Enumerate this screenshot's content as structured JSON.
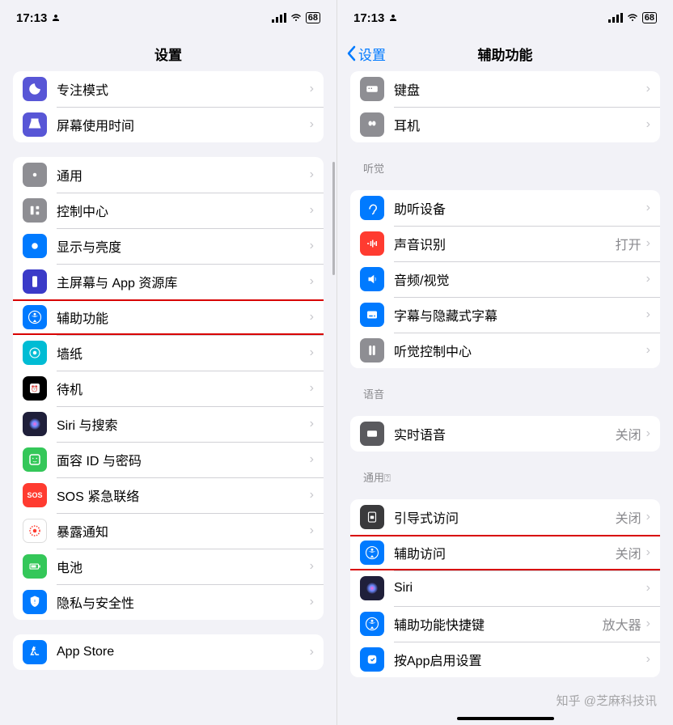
{
  "statusbar": {
    "time": "17:13",
    "battery": "68"
  },
  "left": {
    "title": "设置",
    "g1": [
      {
        "n": "focus",
        "l": "专注模式",
        "c": "#5856d6"
      },
      {
        "n": "screentime",
        "l": "屏幕使用时间",
        "c": "#5856d6"
      }
    ],
    "g2": [
      {
        "n": "general",
        "l": "通用",
        "c": "#8e8e93"
      },
      {
        "n": "control",
        "l": "控制中心",
        "c": "#8e8e93"
      },
      {
        "n": "display",
        "l": "显示与亮度",
        "c": "#007aff"
      },
      {
        "n": "home",
        "l": "主屏幕与 App 资源库",
        "c": "#3a3ac8"
      },
      {
        "n": "accessibility",
        "l": "辅助功能",
        "c": "#007aff",
        "hl": true
      },
      {
        "n": "wallpaper",
        "l": "墙纸",
        "c": "#00bcd4"
      },
      {
        "n": "standby",
        "l": "待机",
        "c": "#000000"
      },
      {
        "n": "siri",
        "l": "Siri 与搜索",
        "c": "#1f1f3a"
      },
      {
        "n": "faceid",
        "l": "面容 ID 与密码",
        "c": "#34c759"
      },
      {
        "n": "sos",
        "l": "SOS 紧急联络",
        "c": "#ff3b30",
        "txt": "SOS"
      },
      {
        "n": "exposure",
        "l": "暴露通知",
        "c": "#ffffff",
        "red": true
      },
      {
        "n": "battery",
        "l": "电池",
        "c": "#34c759"
      },
      {
        "n": "privacy",
        "l": "隐私与安全性",
        "c": "#007aff"
      }
    ],
    "g3": [
      {
        "n": "appstore",
        "l": "App Store",
        "c": "#007aff"
      }
    ]
  },
  "right": {
    "back": "设置",
    "title": "辅助功能",
    "g0": [
      {
        "n": "keyboard",
        "l": "键盘",
        "c": "#8e8e93"
      },
      {
        "n": "airpods",
        "l": "耳机",
        "c": "#8e8e93"
      }
    ],
    "h1": "听觉",
    "g1": [
      {
        "n": "hearing",
        "l": "助听设备",
        "c": "#007aff"
      },
      {
        "n": "sound",
        "l": "声音识别",
        "c": "#ff3b30",
        "v": "打开"
      },
      {
        "n": "audio",
        "l": "音频/视觉",
        "c": "#007aff"
      },
      {
        "n": "subtitle",
        "l": "字幕与隐藏式字幕",
        "c": "#007aff"
      },
      {
        "n": "hearctl",
        "l": "听觉控制中心",
        "c": "#8e8e93"
      }
    ],
    "h2": "语音",
    "g2": [
      {
        "n": "live",
        "l": "实时语音",
        "c": "#5a5a5e",
        "v": "关闭"
      }
    ],
    "h3": "通用⍰",
    "g3": [
      {
        "n": "guided",
        "l": "引导式访问",
        "c": "#3a3a3c",
        "v": "关闭"
      },
      {
        "n": "assist",
        "l": "辅助访问",
        "c": "#007aff",
        "v": "关闭",
        "hl": true
      },
      {
        "n": "siri2",
        "l": "Siri",
        "c": "#1f1f3a"
      },
      {
        "n": "shortcut",
        "l": "辅助功能快捷键",
        "c": "#007aff",
        "v": "放大器"
      },
      {
        "n": "perapp",
        "l": "按App启用设置",
        "c": "#007aff"
      }
    ]
  },
  "watermark": "知乎 @芝麻科技讯"
}
